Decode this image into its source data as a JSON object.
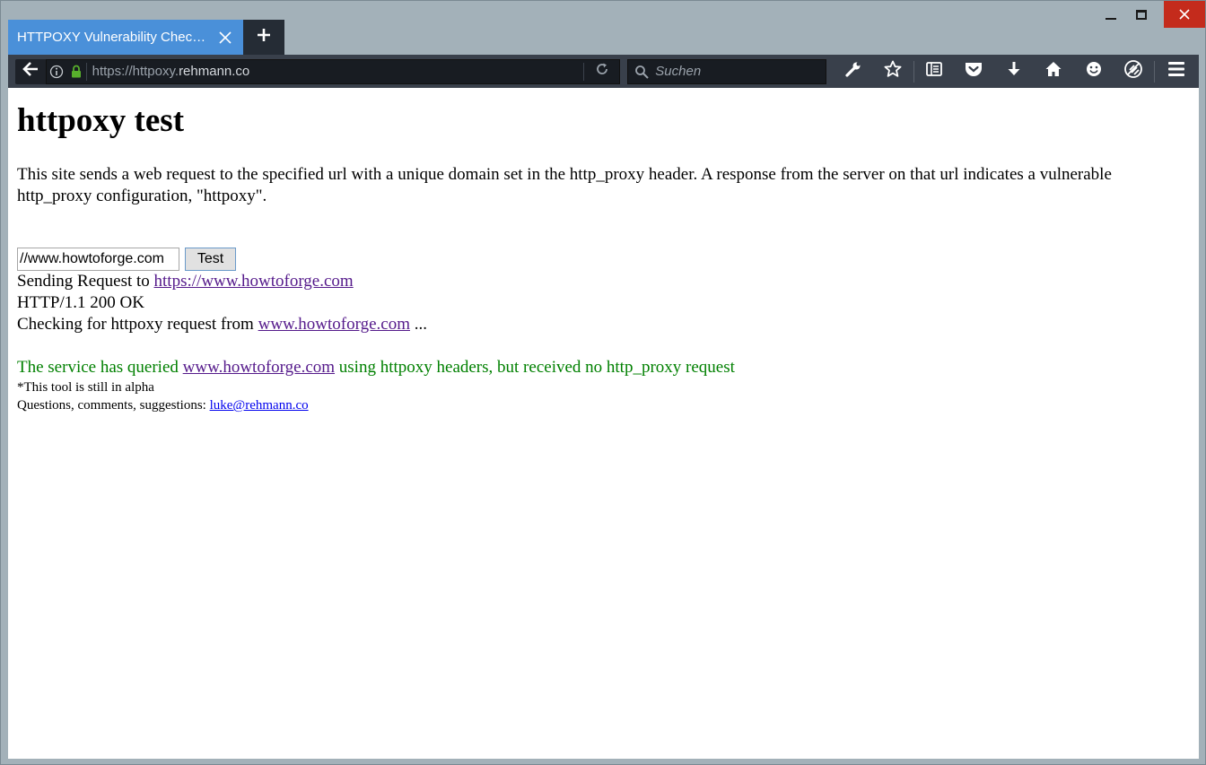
{
  "window": {
    "minimize": "minimize",
    "maximize": "maximize",
    "close": "close"
  },
  "tab": {
    "title": "HTTPOXY Vulnerability Checki..."
  },
  "navbar": {
    "url_prefix": "https://httpoxy.",
    "url_domain": "rehmann.co",
    "search_placeholder": "Suchen"
  },
  "icons": {
    "back": "back-arrow-icon",
    "info": "info-icon",
    "lock": "lock-icon",
    "reload": "reload-icon",
    "search": "search-icon",
    "tools": [
      "wrench-icon",
      "star-icon",
      "reading-list-icon",
      "pocket-icon",
      "download-icon",
      "home-icon",
      "smiley-icon",
      "no-tracking-icon",
      "menu-icon"
    ]
  },
  "colors": {
    "tab_active": "#4a90d9",
    "toolbar": "#39404b",
    "success_text": "#008000",
    "visited_link": "#551a8b",
    "link": "#0000ee"
  },
  "page": {
    "title": "httpoxy test",
    "description": "This site sends a web request to the specified url with a unique domain set in the http_proxy header. A response from the server on that url indicates a vulnerable http_proxy configuration, \"httpoxy\".",
    "input_value": "//www.howtoforge.com",
    "test_button": "Test",
    "sending_prefix": "Sending Request to ",
    "sending_link": "https://www.howtoforge.com",
    "status": "HTTP/1.1 200 OK",
    "checking_prefix": "Checking for httpoxy request from ",
    "checking_link": "www.howtoforge.com",
    "checking_suffix": " ...",
    "result_prefix": "The service has queried ",
    "result_link": "www.howtoforge.com",
    "result_suffix": " using httpoxy headers, but received no http_proxy request",
    "alpha_note": "*This tool is still in alpha",
    "contact_prefix": "Questions, comments, suggestions: ",
    "contact_email": "luke@rehmann.co"
  }
}
